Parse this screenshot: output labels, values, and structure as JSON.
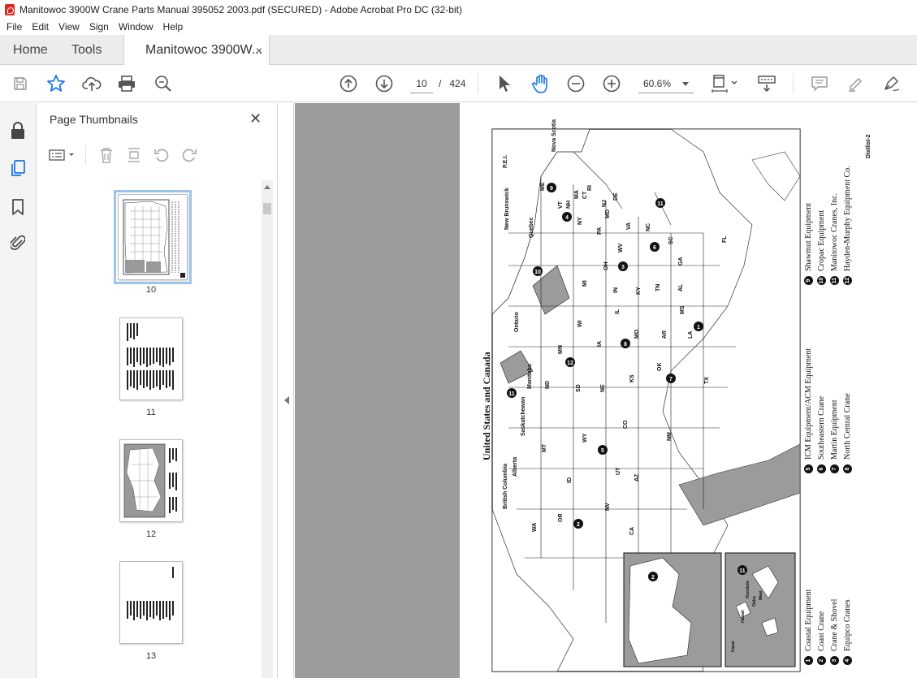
{
  "window": {
    "title": "Manitowoc 3900W Crane Parts Manual 395052 2003.pdf (SECURED) - Adobe Acrobat Pro DC (32-bit)"
  },
  "menu": [
    "File",
    "Edit",
    "View",
    "Sign",
    "Window",
    "Help"
  ],
  "tabs": {
    "home": "Home",
    "tools": "Tools",
    "document": "Manitowoc 3900W...",
    "close_glyph": "×"
  },
  "toolbar": {
    "current_page": "10",
    "page_separator": "/",
    "total_pages": "424",
    "zoom": "60.6%"
  },
  "thumbnails_panel": {
    "title": "Page Thumbnails",
    "close_glyph": "✕",
    "pages": [
      {
        "label": "10",
        "selected": true
      },
      {
        "label": "11",
        "selected": false
      },
      {
        "label": "12",
        "selected": false
      },
      {
        "label": "13",
        "selected": false
      }
    ]
  },
  "document_page": {
    "map_title": "United States and Canada",
    "page_id": "Distlist-2",
    "legend_groups": [
      [
        {
          "num": "1",
          "name": "Coastal Equipment"
        },
        {
          "num": "2",
          "name": "Coast Crane"
        },
        {
          "num": "3",
          "name": "Crane & Shovel"
        },
        {
          "num": "4",
          "name": "Equipco Cranes"
        }
      ],
      [
        {
          "num": "5",
          "name": "ICM Equipment/ACM Equipment"
        },
        {
          "num": "6",
          "name": "Southeastern Crane"
        },
        {
          "num": "7",
          "name": "Martin Equipment"
        },
        {
          "num": "8",
          "name": "North Central Crane"
        }
      ],
      [
        {
          "num": "9",
          "name": "Shawmut Equipment"
        },
        {
          "num": "10",
          "name": "Cropac Equipment"
        },
        {
          "num": "11",
          "name": "Manitowoc Cranes, Inc."
        },
        {
          "num": "12",
          "name": "Hayden-Murphy Equipment Co."
        }
      ]
    ],
    "states": [
      "WA",
      "OR",
      "CA",
      "ID",
      "NV",
      "MT",
      "WY",
      "UT",
      "AZ",
      "CO",
      "NM",
      "ND",
      "SD",
      "NE",
      "KS",
      "OK",
      "TX",
      "MN",
      "IA",
      "MO",
      "AR",
      "LA",
      "WI",
      "IL",
      "MS",
      "MI",
      "IN",
      "KY",
      "TN",
      "AL",
      "OH",
      "GA",
      "FL",
      "SC",
      "NC",
      "VA",
      "WV",
      "PA",
      "NY",
      "VT",
      "NH",
      "ME",
      "MA",
      "CT",
      "RI",
      "NJ",
      "DE",
      "MD"
    ],
    "provinces": [
      "British Columbia",
      "Alberta",
      "Saskatchewan",
      "Manitoba",
      "Ontario",
      "Quebec",
      "New Brunswick",
      "P.E.I.",
      "Nova Scotia"
    ],
    "inset_labels": [
      "Kauai",
      "Hawaii",
      "Honolulu",
      "Oahu",
      "Maui"
    ]
  }
}
